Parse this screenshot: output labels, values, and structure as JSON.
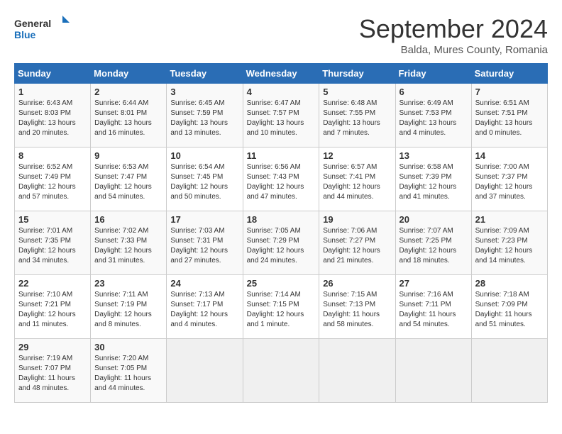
{
  "logo": {
    "line1": "General",
    "line2": "Blue"
  },
  "title": "September 2024",
  "subtitle": "Balda, Mures County, Romania",
  "days_of_week": [
    "Sunday",
    "Monday",
    "Tuesday",
    "Wednesday",
    "Thursday",
    "Friday",
    "Saturday"
  ],
  "weeks": [
    [
      {
        "day": "1",
        "info": "Sunrise: 6:43 AM\nSunset: 8:03 PM\nDaylight: 13 hours\nand 20 minutes."
      },
      {
        "day": "2",
        "info": "Sunrise: 6:44 AM\nSunset: 8:01 PM\nDaylight: 13 hours\nand 16 minutes."
      },
      {
        "day": "3",
        "info": "Sunrise: 6:45 AM\nSunset: 7:59 PM\nDaylight: 13 hours\nand 13 minutes."
      },
      {
        "day": "4",
        "info": "Sunrise: 6:47 AM\nSunset: 7:57 PM\nDaylight: 13 hours\nand 10 minutes."
      },
      {
        "day": "5",
        "info": "Sunrise: 6:48 AM\nSunset: 7:55 PM\nDaylight: 13 hours\nand 7 minutes."
      },
      {
        "day": "6",
        "info": "Sunrise: 6:49 AM\nSunset: 7:53 PM\nDaylight: 13 hours\nand 4 minutes."
      },
      {
        "day": "7",
        "info": "Sunrise: 6:51 AM\nSunset: 7:51 PM\nDaylight: 13 hours\nand 0 minutes."
      }
    ],
    [
      {
        "day": "8",
        "info": "Sunrise: 6:52 AM\nSunset: 7:49 PM\nDaylight: 12 hours\nand 57 minutes."
      },
      {
        "day": "9",
        "info": "Sunrise: 6:53 AM\nSunset: 7:47 PM\nDaylight: 12 hours\nand 54 minutes."
      },
      {
        "day": "10",
        "info": "Sunrise: 6:54 AM\nSunset: 7:45 PM\nDaylight: 12 hours\nand 50 minutes."
      },
      {
        "day": "11",
        "info": "Sunrise: 6:56 AM\nSunset: 7:43 PM\nDaylight: 12 hours\nand 47 minutes."
      },
      {
        "day": "12",
        "info": "Sunrise: 6:57 AM\nSunset: 7:41 PM\nDaylight: 12 hours\nand 44 minutes."
      },
      {
        "day": "13",
        "info": "Sunrise: 6:58 AM\nSunset: 7:39 PM\nDaylight: 12 hours\nand 41 minutes."
      },
      {
        "day": "14",
        "info": "Sunrise: 7:00 AM\nSunset: 7:37 PM\nDaylight: 12 hours\nand 37 minutes."
      }
    ],
    [
      {
        "day": "15",
        "info": "Sunrise: 7:01 AM\nSunset: 7:35 PM\nDaylight: 12 hours\nand 34 minutes."
      },
      {
        "day": "16",
        "info": "Sunrise: 7:02 AM\nSunset: 7:33 PM\nDaylight: 12 hours\nand 31 minutes."
      },
      {
        "day": "17",
        "info": "Sunrise: 7:03 AM\nSunset: 7:31 PM\nDaylight: 12 hours\nand 27 minutes."
      },
      {
        "day": "18",
        "info": "Sunrise: 7:05 AM\nSunset: 7:29 PM\nDaylight: 12 hours\nand 24 minutes."
      },
      {
        "day": "19",
        "info": "Sunrise: 7:06 AM\nSunset: 7:27 PM\nDaylight: 12 hours\nand 21 minutes."
      },
      {
        "day": "20",
        "info": "Sunrise: 7:07 AM\nSunset: 7:25 PM\nDaylight: 12 hours\nand 18 minutes."
      },
      {
        "day": "21",
        "info": "Sunrise: 7:09 AM\nSunset: 7:23 PM\nDaylight: 12 hours\nand 14 minutes."
      }
    ],
    [
      {
        "day": "22",
        "info": "Sunrise: 7:10 AM\nSunset: 7:21 PM\nDaylight: 12 hours\nand 11 minutes."
      },
      {
        "day": "23",
        "info": "Sunrise: 7:11 AM\nSunset: 7:19 PM\nDaylight: 12 hours\nand 8 minutes."
      },
      {
        "day": "24",
        "info": "Sunrise: 7:13 AM\nSunset: 7:17 PM\nDaylight: 12 hours\nand 4 minutes."
      },
      {
        "day": "25",
        "info": "Sunrise: 7:14 AM\nSunset: 7:15 PM\nDaylight: 12 hours\nand 1 minute."
      },
      {
        "day": "26",
        "info": "Sunrise: 7:15 AM\nSunset: 7:13 PM\nDaylight: 11 hours\nand 58 minutes."
      },
      {
        "day": "27",
        "info": "Sunrise: 7:16 AM\nSunset: 7:11 PM\nDaylight: 11 hours\nand 54 minutes."
      },
      {
        "day": "28",
        "info": "Sunrise: 7:18 AM\nSunset: 7:09 PM\nDaylight: 11 hours\nand 51 minutes."
      }
    ],
    [
      {
        "day": "29",
        "info": "Sunrise: 7:19 AM\nSunset: 7:07 PM\nDaylight: 11 hours\nand 48 minutes."
      },
      {
        "day": "30",
        "info": "Sunrise: 7:20 AM\nSunset: 7:05 PM\nDaylight: 11 hours\nand 44 minutes."
      },
      {
        "day": "",
        "info": ""
      },
      {
        "day": "",
        "info": ""
      },
      {
        "day": "",
        "info": ""
      },
      {
        "day": "",
        "info": ""
      },
      {
        "day": "",
        "info": ""
      }
    ]
  ]
}
